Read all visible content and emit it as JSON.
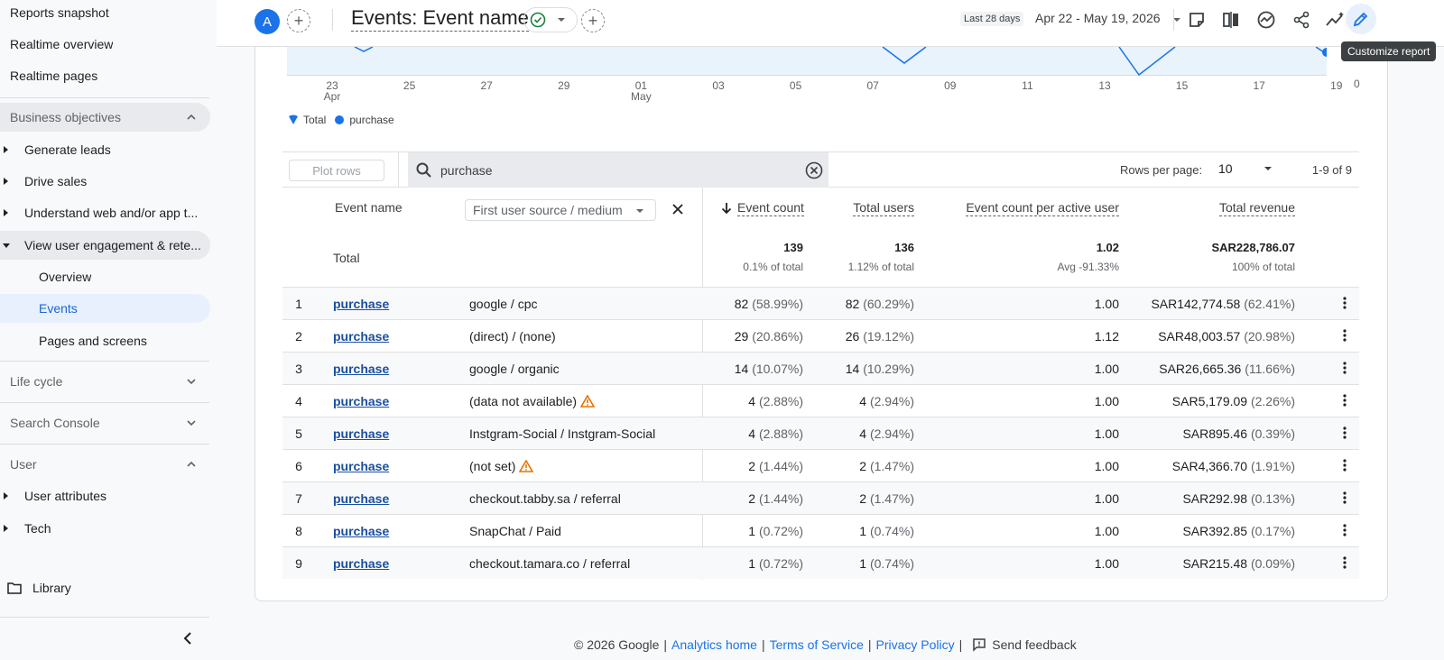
{
  "sidebar": {
    "top_items": [
      "Reports snapshot",
      "Realtime overview",
      "Realtime pages"
    ],
    "business_objectives": {
      "label": "Business objectives",
      "groups": [
        "Generate leads",
        "Drive sales",
        "Understand web and/or app t...",
        "View user engagement & rete..."
      ],
      "sub_items": [
        "Overview",
        "Events",
        "Pages and screens"
      ]
    },
    "life_cycle": "Life cycle",
    "search_console": "Search Console",
    "user": {
      "label": "User",
      "groups": [
        "User attributes",
        "Tech"
      ]
    },
    "library": "Library"
  },
  "header": {
    "avatar_letter": "A",
    "report_title": "Events: Event name",
    "date_chip": "Last 28 days",
    "date_range": "Apr 22 - May 19, 2026",
    "tooltip": "Customize report"
  },
  "chart": {
    "x_ticks": [
      {
        "d": "23",
        "m": "Apr"
      },
      {
        "d": "25",
        "m": ""
      },
      {
        "d": "27",
        "m": ""
      },
      {
        "d": "29",
        "m": ""
      },
      {
        "d": "01",
        "m": "May"
      },
      {
        "d": "03",
        "m": ""
      },
      {
        "d": "05",
        "m": ""
      },
      {
        "d": "07",
        "m": ""
      },
      {
        "d": "09",
        "m": ""
      },
      {
        "d": "11",
        "m": ""
      },
      {
        "d": "13",
        "m": ""
      },
      {
        "d": "15",
        "m": ""
      },
      {
        "d": "17",
        "m": ""
      },
      {
        "d": "19",
        "m": ""
      }
    ],
    "y_zero": "0",
    "legend": [
      {
        "name": "Total",
        "color": "#1a73e8"
      },
      {
        "name": "purchase",
        "color": "#1a73e8"
      }
    ]
  },
  "toolbar": {
    "plot_rows": "Plot rows",
    "search_value": "purchase",
    "rows_per_page_label": "Rows per page:",
    "rows_per_page": "10",
    "page_count": "1-9 of 9"
  },
  "table": {
    "dim_header": "Event name",
    "secondary_dim": "First user source / medium",
    "metric_headers": [
      "Event count",
      "Total users",
      "Event count per active user",
      "Total revenue"
    ],
    "total_label": "Total",
    "totals": [
      {
        "value": "139",
        "sub": "0.1% of total"
      },
      {
        "value": "136",
        "sub": "1.12% of total"
      },
      {
        "value": "1.02",
        "sub": "Avg -91.33%"
      },
      {
        "value": "SAR228,786.07",
        "sub": "100% of total"
      }
    ],
    "rows": [
      {
        "idx": "1",
        "event": "purchase",
        "source": "google / cpc",
        "warn": false,
        "ec": "82",
        "ec_pct": "(58.99%)",
        "tu": "82",
        "tu_pct": "(60.29%)",
        "ecpu": "1.00",
        "rev": "SAR142,774.58",
        "rev_pct": "(62.41%)"
      },
      {
        "idx": "2",
        "event": "purchase",
        "source": "(direct) / (none)",
        "warn": false,
        "ec": "29",
        "ec_pct": "(20.86%)",
        "tu": "26",
        "tu_pct": "(19.12%)",
        "ecpu": "1.12",
        "rev": "SAR48,003.57",
        "rev_pct": "(20.98%)"
      },
      {
        "idx": "3",
        "event": "purchase",
        "source": "google / organic",
        "warn": false,
        "ec": "14",
        "ec_pct": "(10.07%)",
        "tu": "14",
        "tu_pct": "(10.29%)",
        "ecpu": "1.00",
        "rev": "SAR26,665.36",
        "rev_pct": "(11.66%)"
      },
      {
        "idx": "4",
        "event": "purchase",
        "source": "(data not available)",
        "warn": true,
        "ec": "4",
        "ec_pct": "(2.88%)",
        "tu": "4",
        "tu_pct": "(2.94%)",
        "ecpu": "1.00",
        "rev": "SAR5,179.09",
        "rev_pct": "(2.26%)"
      },
      {
        "idx": "5",
        "event": "purchase",
        "source": "Instgram-Social / Instgram-Social",
        "warn": false,
        "ec": "4",
        "ec_pct": "(2.88%)",
        "tu": "4",
        "tu_pct": "(2.94%)",
        "ecpu": "1.00",
        "rev": "SAR895.46",
        "rev_pct": "(0.39%)"
      },
      {
        "idx": "6",
        "event": "purchase",
        "source": "(not set)",
        "warn": true,
        "ec": "2",
        "ec_pct": "(1.44%)",
        "tu": "2",
        "tu_pct": "(1.47%)",
        "ecpu": "1.00",
        "rev": "SAR4,366.70",
        "rev_pct": "(1.91%)"
      },
      {
        "idx": "7",
        "event": "purchase",
        "source": "checkout.tabby.sa / referral",
        "warn": false,
        "ec": "2",
        "ec_pct": "(1.44%)",
        "tu": "2",
        "tu_pct": "(1.47%)",
        "ecpu": "1.00",
        "rev": "SAR292.98",
        "rev_pct": "(0.13%)"
      },
      {
        "idx": "8",
        "event": "purchase",
        "source": "SnapChat / Paid",
        "warn": false,
        "ec": "1",
        "ec_pct": "(0.72%)",
        "tu": "1",
        "tu_pct": "(0.74%)",
        "ecpu": "1.00",
        "rev": "SAR392.85",
        "rev_pct": "(0.17%)"
      },
      {
        "idx": "9",
        "event": "purchase",
        "source": "checkout.tamara.co / referral",
        "warn": false,
        "ec": "1",
        "ec_pct": "(0.72%)",
        "tu": "1",
        "tu_pct": "(0.74%)",
        "ecpu": "1.00",
        "rev": "SAR215.48",
        "rev_pct": "(0.09%)"
      }
    ]
  },
  "footer": {
    "copyright": "© 2026 Google",
    "analytics_home": "Analytics home",
    "terms": "Terms of Service",
    "privacy": "Privacy Policy",
    "feedback": "Send feedback",
    "sep": "|"
  },
  "colors": {
    "accent": "#1a73e8",
    "link": "#1a4fa0",
    "warning": "#e37400",
    "selected_bg": "#e8f0fe"
  }
}
